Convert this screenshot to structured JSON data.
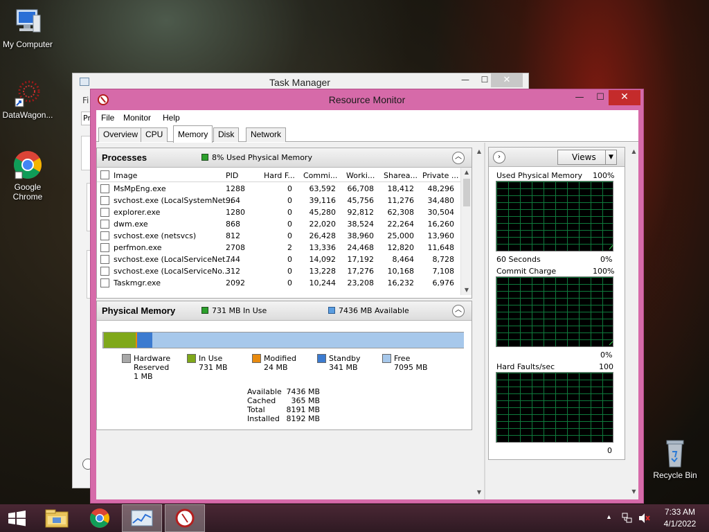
{
  "desktop": {
    "icons": [
      {
        "label": "My Computer"
      },
      {
        "label": "DataWagon..."
      },
      {
        "label": "Google Chrome"
      },
      {
        "label": "Recycle Bin"
      }
    ]
  },
  "task_manager": {
    "title": "Task Manager",
    "menu_first": "Fi",
    "tab_first": "Pr"
  },
  "resource_monitor": {
    "title": "Resource Monitor",
    "menu": [
      "File",
      "Monitor",
      "Help"
    ],
    "tabs": [
      "Overview",
      "CPU",
      "Memory",
      "Disk",
      "Network"
    ],
    "active_tab": "Memory",
    "processes": {
      "header": "Processes",
      "status": "8% Used Physical Memory",
      "columns": [
        "Image",
        "PID",
        "Hard F...",
        "Commi...",
        "Worki...",
        "Sharea...",
        "Private ..."
      ],
      "rows": [
        [
          "MsMpEng.exe",
          "1288",
          "0",
          "63,592",
          "66,708",
          "18,412",
          "48,296"
        ],
        [
          "svchost.exe (LocalSystemNet...",
          "964",
          "0",
          "39,116",
          "45,756",
          "11,276",
          "34,480"
        ],
        [
          "explorer.exe",
          "1280",
          "0",
          "45,280",
          "92,812",
          "62,308",
          "30,504"
        ],
        [
          "dwm.exe",
          "868",
          "0",
          "22,020",
          "38,524",
          "22,264",
          "16,260"
        ],
        [
          "svchost.exe (netsvcs)",
          "812",
          "0",
          "26,428",
          "38,960",
          "25,000",
          "13,960"
        ],
        [
          "perfmon.exe",
          "2708",
          "2",
          "13,336",
          "24,468",
          "12,820",
          "11,648"
        ],
        [
          "svchost.exe (LocalServiceNet...",
          "744",
          "0",
          "14,092",
          "17,192",
          "8,464",
          "8,728"
        ],
        [
          "svchost.exe (LocalServiceNo...",
          "312",
          "0",
          "13,228",
          "17,276",
          "10,168",
          "7,108"
        ],
        [
          "Taskmgr.exe",
          "2092",
          "0",
          "10,244",
          "23,208",
          "16,232",
          "6,976"
        ]
      ]
    },
    "physical_memory": {
      "header": "Physical Memory",
      "in_use_label": "731 MB In Use",
      "available_label": "7436 MB Available",
      "bar_fractions": {
        "hardware": 0.0001,
        "in_use": 0.0892,
        "modified": 0.0029,
        "standby": 0.0416,
        "free": 0.8662
      },
      "legend": [
        {
          "name": "Hardware Reserved",
          "value": "1 MB",
          "color": "#a8a8a8"
        },
        {
          "name": "In Use",
          "value": "731 MB",
          "color": "#7fa81a"
        },
        {
          "name": "Modified",
          "value": "24 MB",
          "color": "#e88a0e"
        },
        {
          "name": "Standby",
          "value": "341 MB",
          "color": "#3c7bd0"
        },
        {
          "name": "Free",
          "value": "7095 MB",
          "color": "#a7c8eb"
        }
      ],
      "stats": [
        {
          "label": "Available",
          "value": "7436 MB"
        },
        {
          "label": "Cached",
          "value": "365 MB"
        },
        {
          "label": "Total",
          "value": "8191 MB"
        },
        {
          "label": "Installed",
          "value": "8192 MB"
        }
      ]
    },
    "graphs": {
      "views_label": "Views",
      "used_physical": {
        "label": "Used Physical Memory",
        "max": "100%",
        "min": "0%",
        "time": "60 Seconds"
      },
      "commit_charge": {
        "label": "Commit Charge",
        "max": "100%",
        "min": "0%"
      },
      "hard_faults": {
        "label": "Hard Faults/sec",
        "max": "100",
        "min": "0"
      }
    }
  },
  "taskbar": {
    "time": "7:33 AM",
    "date": "4/1/2022"
  }
}
